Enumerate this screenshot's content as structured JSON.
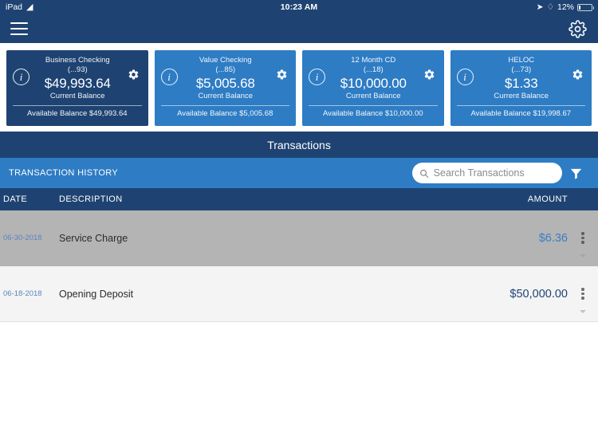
{
  "status_bar": {
    "device": "iPad",
    "wifi_icon": "wifi-icon",
    "time": "10:23 AM",
    "location_icon": "location-arrow-icon",
    "bluetooth_icon": "bluetooth-icon",
    "battery_percent": "12%",
    "battery_icon": "battery-icon"
  },
  "navbar": {
    "menu_icon": "hamburger-menu-icon",
    "settings_icon": "gear-icon"
  },
  "accounts": [
    {
      "name": "Business Checking",
      "mask": "(...93)",
      "balance": "$49,993.64",
      "balance_label": "Current Balance",
      "available": "Available Balance $49,993.64",
      "selected": true,
      "info_icon": "info-icon",
      "gear_icon": "gear-icon"
    },
    {
      "name": "Value Checking",
      "mask": "(...85)",
      "balance": "$5,005.68",
      "balance_label": "Current Balance",
      "available": "Available Balance $5,005.68",
      "selected": false,
      "info_icon": "info-icon",
      "gear_icon": "gear-icon"
    },
    {
      "name": "12 Month CD",
      "mask": "(...18)",
      "balance": "$10,000.00",
      "balance_label": "Current Balance",
      "available": "Available Balance $10,000.00",
      "selected": false,
      "info_icon": "info-icon",
      "gear_icon": "gear-icon"
    },
    {
      "name": "HELOC",
      "mask": "(...73)",
      "balance": "$1.33",
      "balance_label": "Current Balance",
      "available": "Available Balance $19,998.67",
      "selected": false,
      "info_icon": "info-icon",
      "gear_icon": "gear-icon"
    }
  ],
  "section": {
    "title": "Transactions",
    "history_label": "TRANSACTION HISTORY",
    "search_placeholder": "Search Transactions",
    "search_value": "",
    "search_icon": "search-icon",
    "filter_icon": "filter-funnel-icon"
  },
  "table": {
    "columns": {
      "date": "DATE",
      "description": "DESCRIPTION",
      "amount": "AMOUNT"
    },
    "rows": [
      {
        "date": "06-30-2018",
        "description": "Service Charge",
        "amount": "$6.36",
        "selected": true,
        "menu_icon": "overflow-menu-icon",
        "expand_icon": "chevron-down-icon"
      },
      {
        "date": "06-18-2018",
        "description": "Opening Deposit",
        "amount": "$50,000.00",
        "selected": false,
        "menu_icon": "overflow-menu-icon",
        "expand_icon": "chevron-down-icon"
      }
    ]
  },
  "colors": {
    "navy": "#1e4372",
    "blue": "#2e7cc4",
    "selected_row": "#b4b4b4",
    "alt_row": "#f4f4f4",
    "amount_blue": "#3b7fc4",
    "date_blue": "#5a86bf"
  }
}
